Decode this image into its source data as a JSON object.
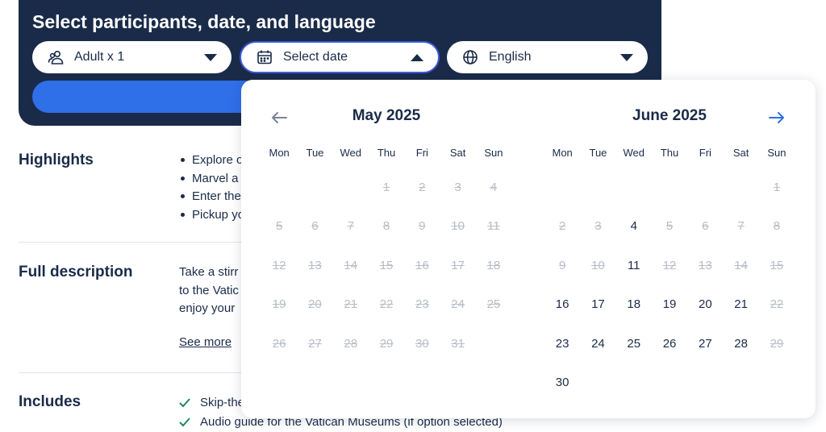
{
  "booking": {
    "title": "Select participants, date, and language",
    "participants": {
      "label": "Adult x 1",
      "icon": "people-icon"
    },
    "date": {
      "label": "Select date",
      "icon": "calendar-icon"
    },
    "language": {
      "label": "English",
      "icon": "globe-icon"
    }
  },
  "page": {
    "highlights": {
      "title": "Highlights",
      "items": [
        "Explore o",
        "Marvel a",
        "Enter the",
        "Pickup yo"
      ]
    },
    "full_description": {
      "title": "Full description",
      "lines": [
        "Take a stirr",
        "to the Vatic",
        "enjoy your"
      ],
      "see_more": "See more"
    },
    "includes": {
      "title": "Includes",
      "items": [
        "Skip-the",
        "Audio guide for the Vatican Museums (if option selected)"
      ]
    }
  },
  "calendar": {
    "weekdays": [
      "Mon",
      "Tue",
      "Wed",
      "Thu",
      "Fri",
      "Sat",
      "Sun"
    ],
    "months": [
      {
        "title": "May 2025",
        "leading_blanks": 3,
        "days": [
          {
            "d": "1",
            "a": false
          },
          {
            "d": "2",
            "a": false
          },
          {
            "d": "3",
            "a": false
          },
          {
            "d": "4",
            "a": false
          },
          {
            "d": "5",
            "a": false
          },
          {
            "d": "6",
            "a": false
          },
          {
            "d": "7",
            "a": false
          },
          {
            "d": "8",
            "a": false
          },
          {
            "d": "9",
            "a": false
          },
          {
            "d": "10",
            "a": false
          },
          {
            "d": "11",
            "a": false
          },
          {
            "d": "12",
            "a": false
          },
          {
            "d": "13",
            "a": false
          },
          {
            "d": "14",
            "a": false
          },
          {
            "d": "15",
            "a": false
          },
          {
            "d": "16",
            "a": false
          },
          {
            "d": "17",
            "a": false
          },
          {
            "d": "18",
            "a": false
          },
          {
            "d": "19",
            "a": false
          },
          {
            "d": "20",
            "a": false
          },
          {
            "d": "21",
            "a": false
          },
          {
            "d": "22",
            "a": false
          },
          {
            "d": "23",
            "a": false
          },
          {
            "d": "24",
            "a": false
          },
          {
            "d": "25",
            "a": false
          },
          {
            "d": "26",
            "a": false
          },
          {
            "d": "27",
            "a": false
          },
          {
            "d": "28",
            "a": false
          },
          {
            "d": "29",
            "a": false
          },
          {
            "d": "30",
            "a": false
          },
          {
            "d": "31",
            "a": false
          }
        ]
      },
      {
        "title": "June 2025",
        "leading_blanks": 6,
        "days": [
          {
            "d": "1",
            "a": false
          },
          {
            "d": "2",
            "a": false
          },
          {
            "d": "3",
            "a": false
          },
          {
            "d": "4",
            "a": true
          },
          {
            "d": "5",
            "a": false
          },
          {
            "d": "6",
            "a": false
          },
          {
            "d": "7",
            "a": false
          },
          {
            "d": "8",
            "a": false
          },
          {
            "d": "9",
            "a": false
          },
          {
            "d": "10",
            "a": false
          },
          {
            "d": "11",
            "a": true
          },
          {
            "d": "12",
            "a": false
          },
          {
            "d": "13",
            "a": false
          },
          {
            "d": "14",
            "a": false
          },
          {
            "d": "15",
            "a": false
          },
          {
            "d": "16",
            "a": true
          },
          {
            "d": "17",
            "a": true
          },
          {
            "d": "18",
            "a": true
          },
          {
            "d": "19",
            "a": true
          },
          {
            "d": "20",
            "a": true
          },
          {
            "d": "21",
            "a": true
          },
          {
            "d": "22",
            "a": false
          },
          {
            "d": "23",
            "a": true
          },
          {
            "d": "24",
            "a": true
          },
          {
            "d": "25",
            "a": true
          },
          {
            "d": "26",
            "a": true
          },
          {
            "d": "27",
            "a": true
          },
          {
            "d": "28",
            "a": true
          },
          {
            "d": "29",
            "a": false
          },
          {
            "d": "30",
            "a": true
          }
        ]
      }
    ]
  },
  "colors": {
    "panel": "#1a2b49",
    "accent": "#2f6fe8",
    "text": "#1a2b49",
    "unavailable": "#b8bdc7",
    "check": "#1e8a5a"
  }
}
